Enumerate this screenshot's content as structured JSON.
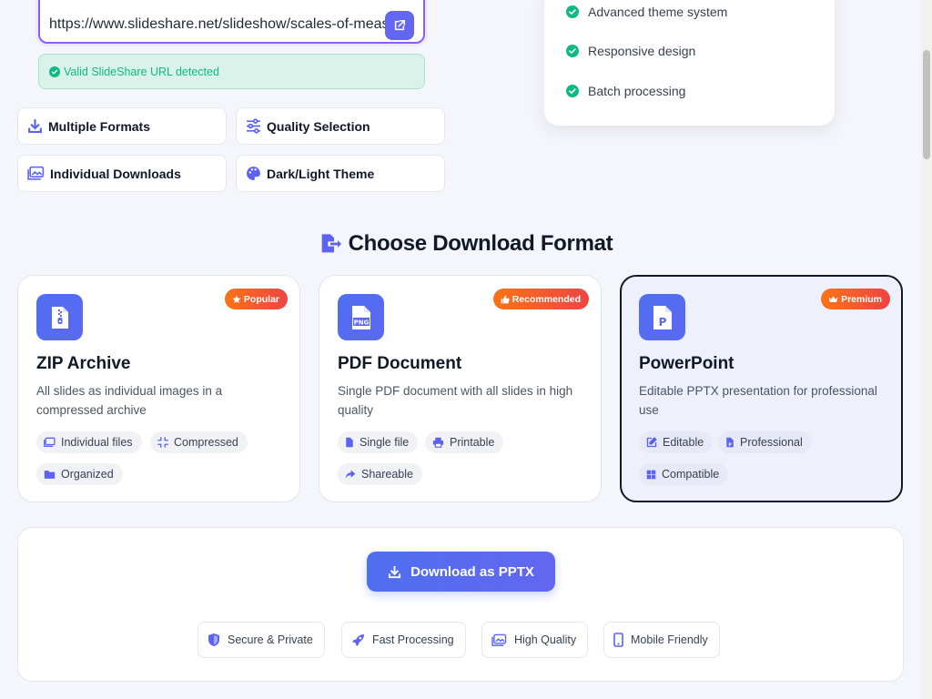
{
  "url_input": {
    "value": "https://www.slideshare.net/slideshow/scales-of-meas"
  },
  "validation": {
    "message": "Valid SlideShare URL detected"
  },
  "features": [
    {
      "label": "Multiple Formats",
      "icon": "download-icon"
    },
    {
      "label": "Quality Selection",
      "icon": "sliders-icon"
    },
    {
      "label": "Individual Downloads",
      "icon": "images-icon"
    },
    {
      "label": "Dark/Light Theme",
      "icon": "palette-icon"
    }
  ],
  "side_card": {
    "items": [
      {
        "label": "Advanced theme system"
      },
      {
        "label": "Responsive design"
      },
      {
        "label": "Batch processing"
      }
    ]
  },
  "section": {
    "title": "Choose Download Format"
  },
  "formats": [
    {
      "title": "ZIP Archive",
      "description": "All slides as individual images in a compressed archive",
      "badge": "Popular",
      "badge_icon": "star-icon",
      "icon": "zip-file-icon",
      "tags": [
        {
          "label": "Individual files",
          "icon": "images-icon"
        },
        {
          "label": "Compressed",
          "icon": "compress-icon"
        },
        {
          "label": "Organized",
          "icon": "folder-icon"
        }
      ]
    },
    {
      "title": "PDF Document",
      "description": "Single PDF document with all slides in high quality",
      "badge": "Recommended",
      "badge_icon": "thumbs-up-icon",
      "icon": "png-file-icon",
      "tags": [
        {
          "label": "Single file",
          "icon": "file-icon"
        },
        {
          "label": "Printable",
          "icon": "printer-icon"
        },
        {
          "label": "Shareable",
          "icon": "share-icon"
        }
      ]
    },
    {
      "title": "PowerPoint",
      "description": "Editable PPTX presentation for professional use",
      "badge": "Premium",
      "badge_icon": "crown-icon",
      "icon": "pptx-file-icon",
      "tags": [
        {
          "label": "Editable",
          "icon": "edit-icon"
        },
        {
          "label": "Professional",
          "icon": "file-powerpoint-icon"
        },
        {
          "label": "Compatible",
          "icon": "windows-icon"
        }
      ]
    }
  ],
  "download": {
    "button_label": "Download as PPTX"
  },
  "trust_badges": [
    {
      "label": "Secure & Private",
      "icon": "shield-icon"
    },
    {
      "label": "Fast Processing",
      "icon": "rocket-icon"
    },
    {
      "label": "High Quality",
      "icon": "images-icon"
    },
    {
      "label": "Mobile Friendly",
      "icon": "mobile-icon"
    }
  ],
  "colors": {
    "accent": "#6366f1",
    "success": "#10b981",
    "badge_gradient_start": "#f97316",
    "badge_gradient_end": "#ef4444"
  }
}
